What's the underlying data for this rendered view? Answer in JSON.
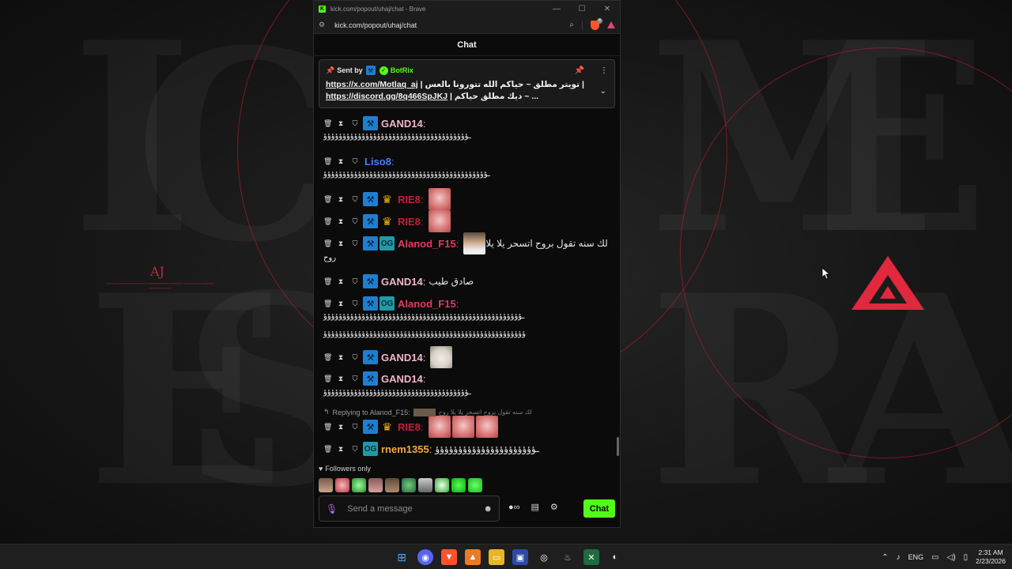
{
  "window": {
    "title": "kick.com/popout/uhaj/chat - Brave",
    "url": "kick.com/popout/uhaj/chat",
    "controls": [
      "—",
      "☐",
      "✕"
    ]
  },
  "chat": {
    "header": "Chat",
    "pinned": {
      "sent_by_label": "Sent by",
      "author": "BotRix",
      "line1_link": "https://x.com/Motlaq_aj",
      "line1_text": "| تويتر مطلق ~ حياكم الله تتورونا بالعس |",
      "line2_link": "https://discord.gg/8q466SpJKJ",
      "line2_text": "| ديك مطلق حياكم ~ ..."
    },
    "messages": [
      {
        "user": "GAND14",
        "color": "#f0b7c6",
        "badges": [
          "mod"
        ],
        "text": "",
        "wrap": "ـؤؤؤؤؤؤؤؤؤؤؤؤؤؤؤؤؤؤؤؤؤؤؤؤؤؤؤؤؤؤؤؤؤؤؤؤؤؤ"
      },
      {
        "user": "Liso8",
        "color": "#4a7ef5",
        "badges": [],
        "text": "",
        "wrap": "ـؤؤؤؤؤؤؤؤؤؤؤؤؤؤؤؤؤؤؤؤؤؤؤؤؤؤؤؤؤؤؤؤؤؤؤؤؤؤؤؤؤؤؤ"
      },
      {
        "user": "RIE8",
        "color": "#c21e3a",
        "badges": [
          "mod",
          "vip"
        ],
        "text": ""
      },
      {
        "user": "RIE8",
        "color": "#c21e3a",
        "badges": [
          "mod",
          "vip"
        ],
        "text": ""
      },
      {
        "user": "Alanod_F15",
        "color": "#e23a5e",
        "badges": [
          "mod",
          "og"
        ],
        "text": "لك سنه تقول بروح اتسحر يلا يلا",
        "wrap": "روح"
      },
      {
        "user": "GAND14",
        "color": "#f0b7c6",
        "badges": [
          "mod"
        ],
        "text": "صادق طيب"
      },
      {
        "user": "Alanod_F15",
        "color": "#e23a5e",
        "badges": [
          "mod",
          "og"
        ],
        "text": "",
        "wrap": "ـؤؤؤؤؤؤؤؤؤؤؤؤؤؤؤؤؤؤؤؤؤؤؤؤؤؤؤؤؤؤؤؤؤؤؤؤؤؤؤؤؤؤؤؤؤؤؤؤؤؤؤؤ",
        "wrap2": "ؤؤؤؤؤؤؤؤؤؤؤؤؤؤؤؤؤؤؤؤؤؤؤؤؤؤؤؤؤؤؤؤؤؤؤؤؤؤؤؤؤؤؤؤؤؤؤؤؤؤؤؤؤ"
      },
      {
        "user": "GAND14",
        "color": "#f0b7c6",
        "badges": [
          "mod"
        ],
        "text": ""
      },
      {
        "user": "GAND14",
        "color": "#f0b7c6",
        "badges": [
          "mod"
        ],
        "text": "",
        "wrap": "ـؤؤؤؤؤؤؤؤؤؤؤؤؤؤؤؤؤؤؤؤؤؤؤؤؤؤؤؤؤؤؤؤؤؤؤؤؤؤ"
      },
      {
        "user": "RIE8",
        "color": "#c21e3a",
        "badges": [
          "mod",
          "vip"
        ],
        "text": ""
      },
      {
        "user": "rnem1355",
        "color": "#f2a83c",
        "badges": [
          "og"
        ],
        "text": "ـؤؤؤؤؤؤؤؤؤؤؤؤؤؤؤؤؤؤؤؤؤؤ"
      }
    ],
    "reply": {
      "label": "Replying to Alanod_F15:",
      "snippet": "لك سنه تقول بروح اتسحر يلا يلا روح"
    },
    "followers_label": "Followers only",
    "input_placeholder": "Send a message",
    "send_button": "Chat"
  },
  "taskbar": {
    "lang": "ENG",
    "time": "2:31 AM",
    "date": "2/23/2026"
  },
  "colors": {
    "kick_green": "#53fc18",
    "accent_red": "#c0283a"
  }
}
